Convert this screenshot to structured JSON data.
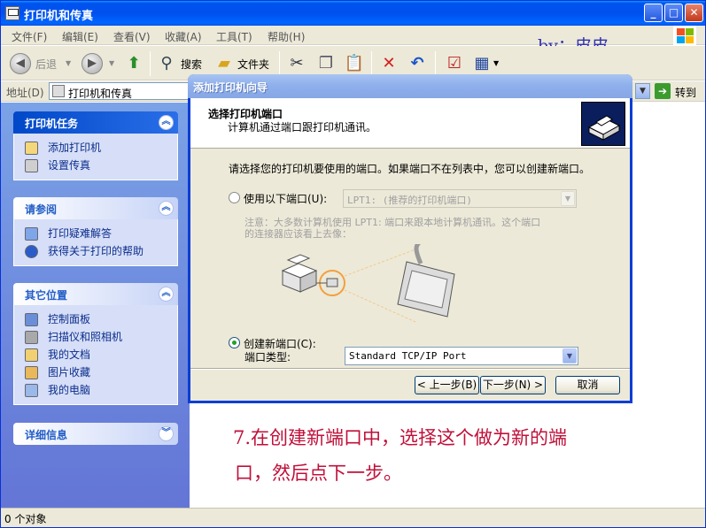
{
  "window": {
    "title": "打印机和传真",
    "byline": "by：皮皮"
  },
  "menu": [
    "文件(F)",
    "编辑(E)",
    "查看(V)",
    "收藏(A)",
    "工具(T)",
    "帮助(H)"
  ],
  "toolbar": {
    "back": "后退",
    "search": "搜索",
    "folders": "文件夹"
  },
  "address": {
    "label": "地址(D)",
    "value": "打印机和传真",
    "go": "转到"
  },
  "taskpane": {
    "printer_tasks": {
      "title": "打印机任务",
      "items": [
        "添加打印机",
        "设置传真"
      ]
    },
    "see_also": {
      "title": "请参阅",
      "items": [
        "打印疑难解答",
        "获得关于打印的帮助"
      ]
    },
    "other_places": {
      "title": "其它位置",
      "items": [
        "控制面板",
        "扫描仪和照相机",
        "我的文档",
        "图片收藏",
        "我的电脑"
      ]
    },
    "details": {
      "title": "详细信息"
    }
  },
  "dialog": {
    "title": "添加打印机向导",
    "header_title": "选择打印机端口",
    "header_subtitle": "计算机通过端口跟打印机通讯。",
    "instruction": "请选择您的打印机要使用的端口。如果端口不在列表中，您可以创建新端口。",
    "use_port_label": "使用以下端口(U):",
    "use_port_value": "LPT1: (推荐的打印机端口)",
    "note_line1": "注意：大多数计算机使用 LPT1: 端口来跟本地计算机通讯。这个端口",
    "note_line2": "的连接器应该看上去像：",
    "create_port_label": "创建新端口(C):",
    "port_type_label": "端口类型:",
    "port_type_value": "Standard TCP/IP Port",
    "back_button": "< 上一步(B)",
    "next_button": "下一步(N) >",
    "cancel_button": "取消"
  },
  "caption": {
    "line1": "7.在创建新端口中，选择这个做为新的端",
    "line2": "口，然后点下一步。"
  },
  "status": "0 个对象"
}
